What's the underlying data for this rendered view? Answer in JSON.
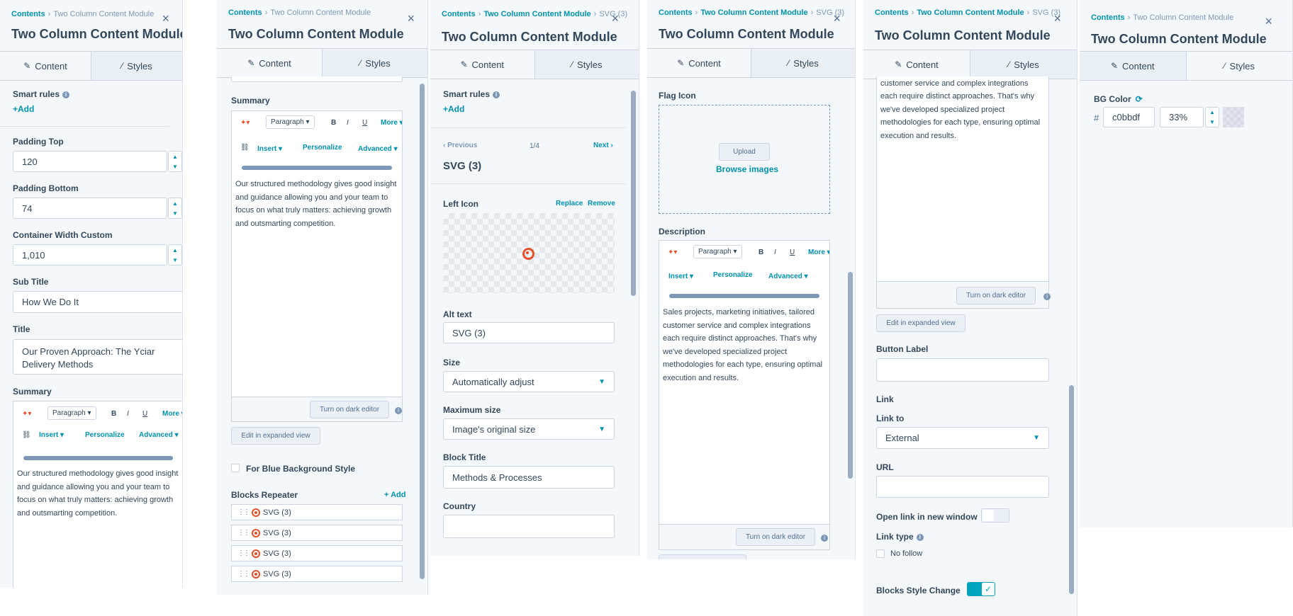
{
  "common": {
    "breadcrumb_root": "Contents",
    "breadcrumb_module": "Two Column Content Module",
    "breadcrumb_svg": "SVG (3)",
    "title": "Two Column Content Module",
    "close": "×",
    "tab_content": "Content",
    "tab_styles": "Styles",
    "pencil": "✎",
    "brush": "⁄",
    "add_plus": "+Add",
    "insert": "Insert ▾",
    "personalize": "Personalize",
    "advanced": "Advanced ▾",
    "paragraph": "Paragraph ▾",
    "bold": "B",
    "italic": "I",
    "underline": "U",
    "more": "More ▾",
    "dark_editor": "Turn on dark editor",
    "expanded_view": "Edit in expanded view",
    "summary_text": "Our structured methodology gives good insight and guidance allowing you and your team to focus on what truly matters: achieving growth and outsmarting competition.",
    "description_text": "Sales projects, marketing initiatives, tailored customer service and complex integrations each require distinct approaches. That's why we've developed specialized project methodologies for each type, ensuring optimal execution and results."
  },
  "panel1": {
    "smart_rules": "Smart rules",
    "padding_top_label": "Padding Top",
    "padding_top": "120",
    "padding_bottom_label": "Padding Bottom",
    "padding_bottom": "74",
    "container_width_label": "Container Width Custom",
    "container_width": "1,010",
    "sub_title_label": "Sub Title",
    "sub_title": "How We Do It",
    "title_label": "Title",
    "title_value": "Our Proven Approach: The Yciar Delivery Methods",
    "summary_label": "Summary"
  },
  "panel2": {
    "summary_label": "Summary",
    "blue_bg": "For Blue Background Style",
    "blocks_repeater": "Blocks Repeater",
    "add": "+ Add",
    "items": [
      "SVG (3)",
      "SVG (3)",
      "SVG (3)",
      "SVG (3)"
    ]
  },
  "panel3": {
    "smart_rules": "Smart rules",
    "previous": "‹ Previous",
    "pager": "1/4",
    "next": "Next ›",
    "heading": "SVG (3)",
    "left_icon": "Left Icon",
    "replace": "Replace",
    "remove": "Remove",
    "alt_text_label": "Alt text",
    "alt_text": "SVG (3)",
    "size_label": "Size",
    "size": "Automatically adjust",
    "max_size_label": "Maximum size",
    "max_size": "Image's original size",
    "block_title_label": "Block Title",
    "block_title": "Methods & Processes",
    "country_label": "Country",
    "country": ""
  },
  "panel4": {
    "flag_icon": "Flag Icon",
    "upload": "Upload",
    "browse": "Browse images",
    "description_label": "Description"
  },
  "panel5": {
    "button_label_label": "Button Label",
    "button_label": "",
    "link_heading": "Link",
    "link_to_label": "Link to",
    "link_to": "External",
    "url_label": "URL",
    "url": "",
    "open_new_window": "Open link in new window",
    "link_type_label": "Link type",
    "no_follow": "No follow",
    "blocks_style_change": "Blocks Style Change",
    "check": "✓"
  },
  "panel6": {
    "bg_color_label": "BG Color",
    "hash": "#",
    "bg_color": "c0bbdf",
    "opacity": "33%"
  },
  "colors": {
    "accent": "#0091ae",
    "text": "#33475b",
    "target": "#e4502a",
    "toggle_on": "#00a4bd"
  }
}
